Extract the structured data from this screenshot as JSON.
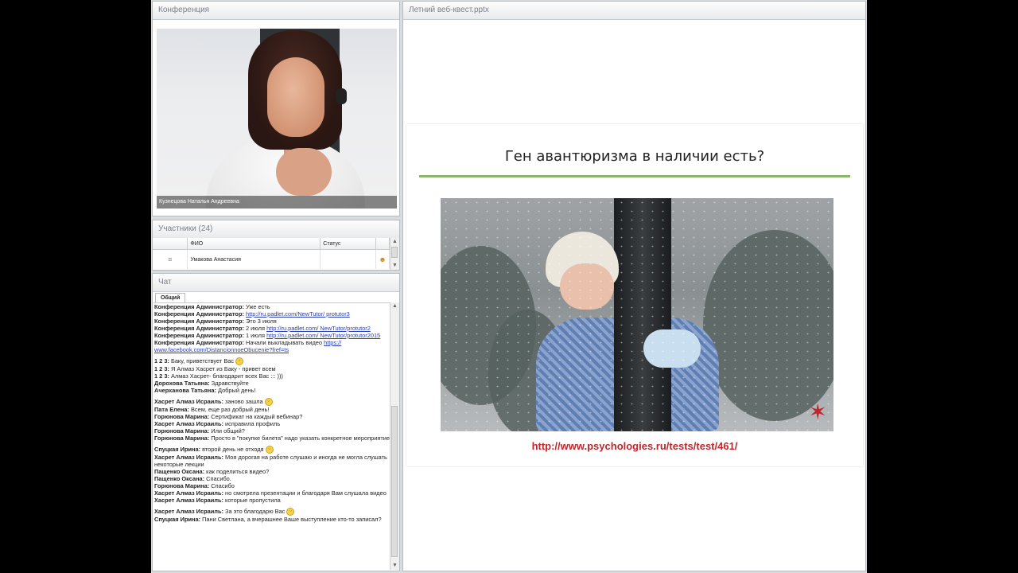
{
  "camera": {
    "title": "Конференция",
    "caption": "Кузнецова Наталья Андреевна"
  },
  "participants": {
    "title": "Участники (24)",
    "columns": {
      "name": "ФИО",
      "status": "Статус"
    },
    "rows": [
      {
        "name": "Умакова Анастасия"
      }
    ]
  },
  "chat": {
    "title": "Чат",
    "tab": "Общий",
    "messages": [
      {
        "sender": "Конференция Администратор:",
        "text": "Уже есть",
        "link": ""
      },
      {
        "sender": "Конференция Администратор:",
        "text": "",
        "link": "http://ru.padlet.com/NewTutor/ protutor3"
      },
      {
        "sender": "Конференция Администратор:",
        "text": "Это 3 июля",
        "link": ""
      },
      {
        "sender": "Конференция Администратор:",
        "text": "2 июля",
        "link": "http://ru.padlet.com/ NewTutor/protutor2"
      },
      {
        "sender": "Конференция Администратор:",
        "text": "1 июля",
        "link": "http://ru.padlet.com/ NewTutor/protutor2015"
      },
      {
        "sender": "Конференция Администратор:",
        "text": "Начали выкладывать видео",
        "link": "https:// www.facebook.com/DistancionnoeObucenie?fref=ts"
      },
      {
        "sender": "1 2 3:",
        "text": "Баку, приветствует Вас",
        "link": ""
      },
      {
        "sender": "1 2 3:",
        "text": "Я Алмаз Хасрет из Баку - привет всем",
        "link": ""
      },
      {
        "sender": "1 2 3:",
        "text": "Алмаз Хасрет- благодарит всех Вас ::: )))",
        "link": ""
      },
      {
        "sender": "Дорохова Татьяна:",
        "text": "Здравствуйте",
        "link": ""
      },
      {
        "sender": "Ачерханова Татьяна:",
        "text": "Добрый день!",
        "link": ""
      },
      {
        "sender": "Хасрет Алмаз Исраиль:",
        "text": "заново зашла",
        "link": ""
      },
      {
        "sender": "Пата Елена:",
        "text": "Всем, еще раз добрый день!",
        "link": ""
      },
      {
        "sender": "Горюнова Марина:",
        "text": "Сертификат на каждый вебинар?",
        "link": ""
      },
      {
        "sender": "Хасрет Алмаз Исраиль:",
        "text": "исправила профиль",
        "link": ""
      },
      {
        "sender": "Горюнова Марина:",
        "text": "Или общий?",
        "link": ""
      },
      {
        "sender": "Горюнова Марина:",
        "text": "Просто в \"покупке билета\" надо указать конкретное мероприятие",
        "link": ""
      },
      {
        "sender": "Спуцкая Ирина:",
        "text": "второй день не отходя",
        "link": ""
      },
      {
        "sender": "Хасрет Алмаз Исраиль:",
        "text": "Моя дорогая на работе слушаю и иногда не могла слушать некоторые лекции",
        "link": ""
      },
      {
        "sender": "Пащенко Оксана:",
        "text": "как поделиться видео?",
        "link": ""
      },
      {
        "sender": "Пащенко Оксана:",
        "text": "Спасибо.",
        "link": ""
      },
      {
        "sender": "Горюнова Марина:",
        "text": "Спасибо",
        "link": ""
      },
      {
        "sender": "Хасрет Алмаз Исраиль:",
        "text": "но смотрела презентации и благодаря Вам слушала видео",
        "link": ""
      },
      {
        "sender": "Хасрет Алмаз Исраиль:",
        "text": "которые пропустила",
        "link": ""
      },
      {
        "sender": "Хасрет Алмаз Исраиль:",
        "text": "За это благодарю Вас",
        "link": ""
      },
      {
        "sender": "Спуцкая Ирина:",
        "text": "Пани Светлана, а вчерашнее Ваше выступление кто-то записал?",
        "link": ""
      }
    ]
  },
  "presentation": {
    "title": "Летний веб-квест.pptx",
    "slide_title": "Ген авантюризма в наличии есть?",
    "slide_link": "http://www.psychologies.ru/tests/test/461/",
    "accent_color": "#8cb66e",
    "link_color": "#c0262b"
  }
}
